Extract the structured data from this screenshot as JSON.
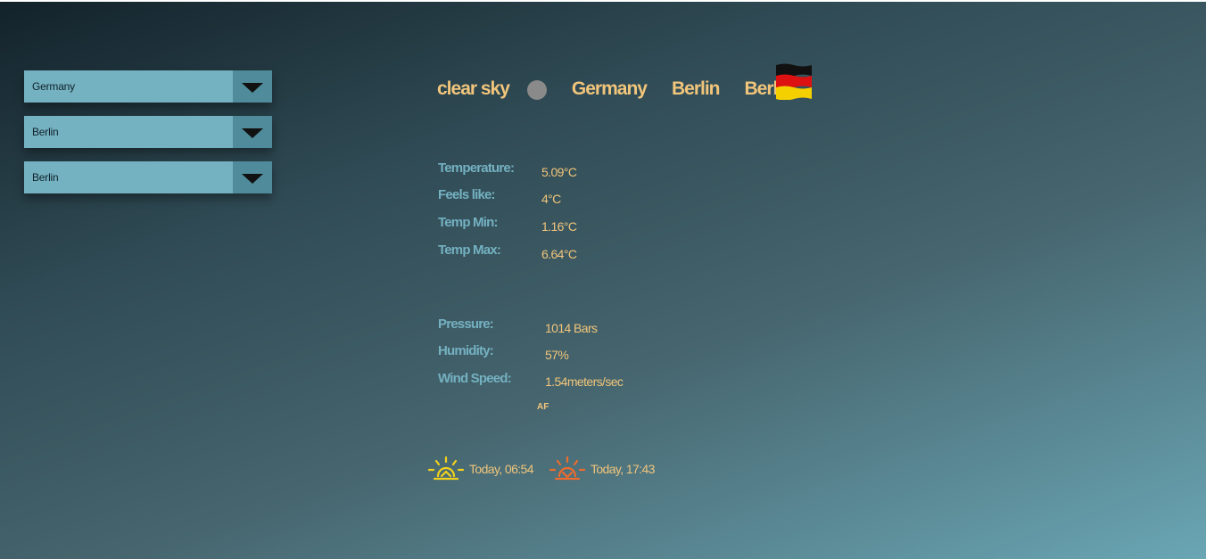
{
  "selects": [
    {
      "value": "Germany"
    },
    {
      "value": "Berlin"
    },
    {
      "value": "Berlin"
    }
  ],
  "header": {
    "condition": "clear sky",
    "country": "Germany",
    "state": "Berlin",
    "city": "Berlin"
  },
  "stats_temp": {
    "temperature_label": "Temperature:",
    "temperature_value": "5.09°C",
    "feels_label": "Feels like:",
    "feels_value": "4°C",
    "min_label": "Temp Min:",
    "min_value": "1.16°C",
    "max_label": "Temp Max:",
    "max_value": "6.64°C"
  },
  "stats_other": {
    "pressure_label": "Pressure:",
    "pressure_value": "1014 Bars",
    "humidity_label": "Humidity:",
    "humidity_value": "57%",
    "wind_label": "Wind Speed:",
    "wind_value": "1.54meters/sec"
  },
  "af_text": "AF",
  "sun": {
    "sunrise": "Today, 06:54",
    "sunset": "Today, 17:43"
  },
  "colors": {
    "accent_gold": "#f1c57b",
    "label_blue": "#74b1c1",
    "sunrise_icon": "#f2d21c",
    "sunset_icon": "#ec6b2d"
  }
}
